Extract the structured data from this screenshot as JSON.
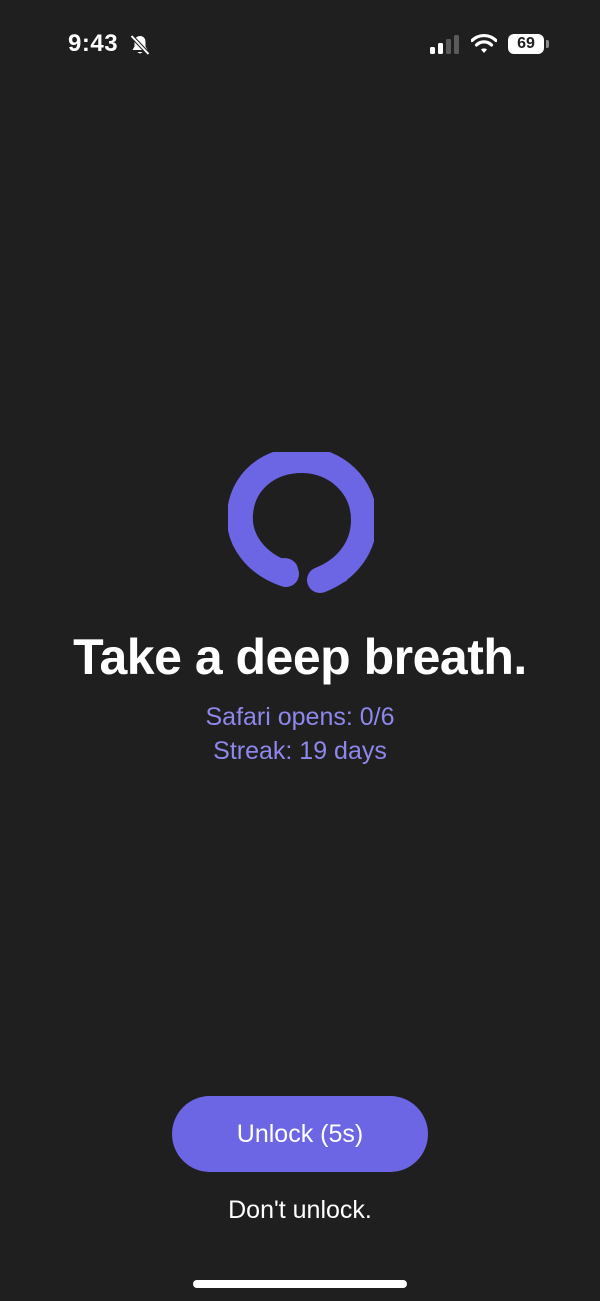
{
  "status_bar": {
    "time": "9:43",
    "battery": "69",
    "icons": [
      "bell-muted-icon",
      "signal-icon",
      "wifi-icon",
      "battery-icon"
    ]
  },
  "logo": {
    "icon": "enso-circle-icon",
    "color": "#6c66e4"
  },
  "main": {
    "headline": "Take a deep breath.",
    "opens": "Safari opens: 0/6",
    "streak": "Streak: 19 days"
  },
  "actions": {
    "unlock_label": "Unlock (5s)",
    "dont_unlock_label": "Don't unlock."
  },
  "colors": {
    "background": "#1f1f1f",
    "accent": "#6c66e4",
    "stat_text": "#8e87ec"
  }
}
